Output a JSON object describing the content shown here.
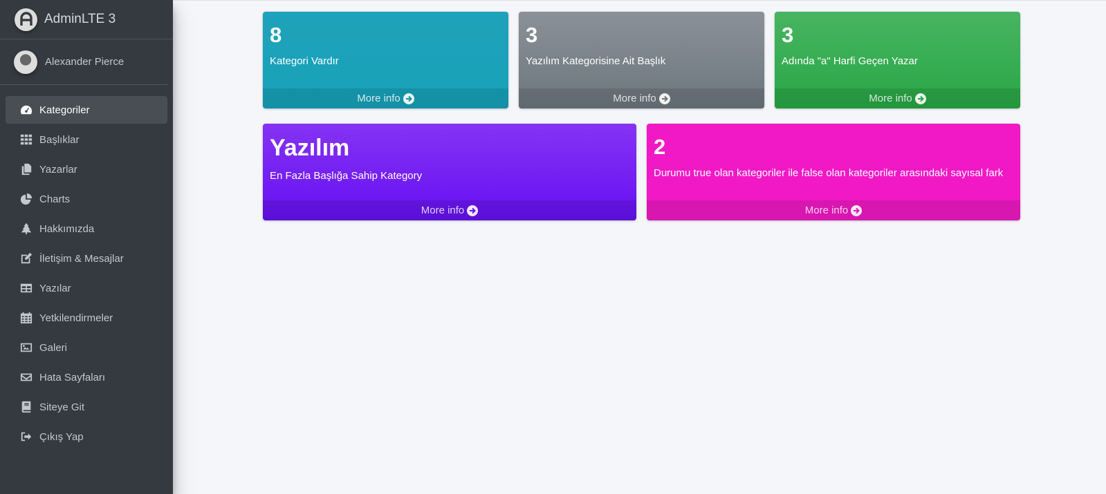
{
  "brand": {
    "name": "AdminLTE 3",
    "logo_icon": "adminlte-logo-icon"
  },
  "user": {
    "name": "Alexander Pierce"
  },
  "sidebar": {
    "items": [
      {
        "label": "Kategoriler",
        "icon": "tachometer-icon",
        "active": true
      },
      {
        "label": "Başlıklar",
        "icon": "grid-icon"
      },
      {
        "label": "Yazarlar",
        "icon": "copy-icon"
      },
      {
        "label": "Charts",
        "icon": "pie-chart-icon"
      },
      {
        "label": "Hakkımızda",
        "icon": "tree-icon"
      },
      {
        "label": "İletişim & Mesajlar",
        "icon": "edit-icon"
      },
      {
        "label": "Yazılar",
        "icon": "table-icon"
      },
      {
        "label": "Yetkilendirmeler",
        "icon": "calendar-icon"
      },
      {
        "label": "Galeri",
        "icon": "image-icon"
      },
      {
        "label": "Hata Sayfaları",
        "icon": "envelope-icon"
      },
      {
        "label": "Siteye Git",
        "icon": "book-icon"
      },
      {
        "label": "Çıkış Yap",
        "icon": "sign-out-icon"
      }
    ]
  },
  "boxes": [
    {
      "value": "8",
      "text": "Kategori Vardır",
      "link": "More info",
      "color": "#17a2b8"
    },
    {
      "value": "3",
      "text": "Yazılım Kategorisine Ait Başlık",
      "link": "More info",
      "color": "#6c757d"
    },
    {
      "value": "3",
      "text": "Adında \"a\" Harfi Geçen Yazar",
      "link": "More info",
      "color": "#28a745"
    },
    {
      "value": "Yazılım",
      "text": "En Fazla Başlığa Sahip Kategory",
      "link": "More info",
      "color": "#6610f2"
    },
    {
      "value": "2",
      "text": "Durumu true olan kategoriler ile false olan kategoriler arasındaki sayısal fark",
      "link": "More info",
      "color": "#f119c5"
    }
  ],
  "colors": {
    "sidebar_bg": "#343a40",
    "content_bg": "#f4f6f9"
  }
}
